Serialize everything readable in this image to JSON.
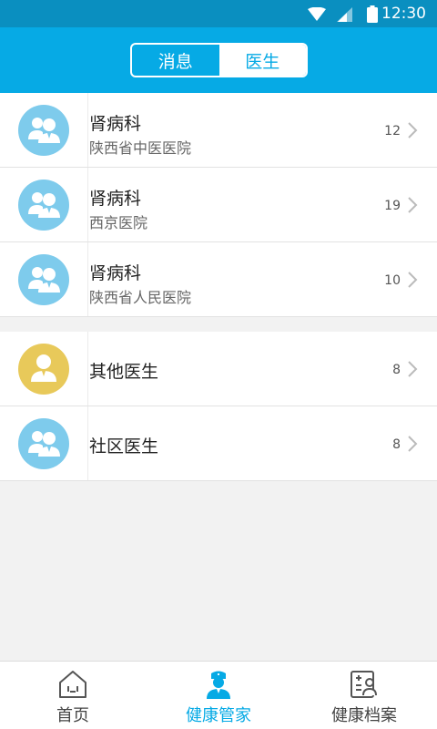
{
  "status_bar": {
    "time": "12:30"
  },
  "header": {
    "tabs": [
      {
        "label": "消息",
        "active": false
      },
      {
        "label": "医生",
        "active": true
      }
    ]
  },
  "groups": [
    {
      "rows": [
        {
          "title": "肾病科",
          "subtitle": "陕西省中医医院",
          "count": "12",
          "avatar": "doctor-group-icon"
        },
        {
          "title": "肾病科",
          "subtitle": "西京医院",
          "count": "19",
          "avatar": "doctor-group-icon"
        },
        {
          "title": "肾病科",
          "subtitle": "陕西省人民医院",
          "count": "10",
          "avatar": "doctor-group-icon"
        }
      ]
    },
    {
      "rows": [
        {
          "title": "其他医生",
          "count": "8",
          "avatar": "doctor-single-icon"
        },
        {
          "title": "社区医生",
          "count": "8",
          "avatar": "doctor-group-icon"
        }
      ]
    }
  ],
  "bottom_nav": {
    "items": [
      {
        "label": "首页",
        "icon": "home-icon",
        "active": false
      },
      {
        "label": "健康管家",
        "icon": "nurse-icon",
        "active": true
      },
      {
        "label": "健康档案",
        "icon": "health-record-icon",
        "active": false
      }
    ]
  },
  "colors": {
    "accent": "#06aae5",
    "status_bar": "#0a8fc0",
    "avatar_blue": "#7ecbec",
    "avatar_yellow": "#e8c95a"
  }
}
